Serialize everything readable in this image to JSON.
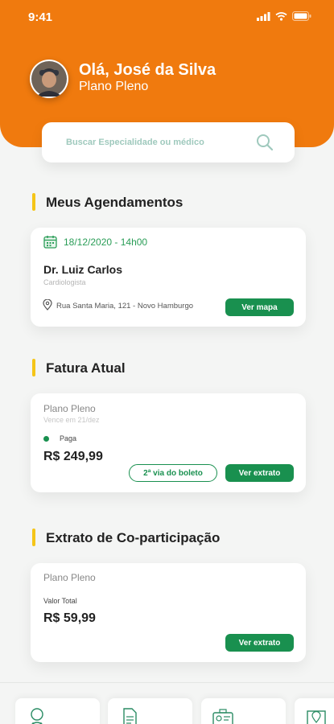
{
  "status_bar": {
    "time": "9:41"
  },
  "user": {
    "greeting": "Olá, José da Silva",
    "plan": "Plano Pleno"
  },
  "search": {
    "placeholder": "Buscar Especialidade ou médico"
  },
  "appointments": {
    "title": "Meus Agendamentos",
    "date": "18/12/2020 - 14h00",
    "doctor": "Dr. Luiz Carlos",
    "specialty": "Cardiologista",
    "address": "Rua Santa Maria, 121 - Novo Hamburgo",
    "map_button": "Ver mapa"
  },
  "invoice": {
    "title": "Fatura Atual",
    "plan": "Plano Pleno",
    "due": "Vence em 21/dez",
    "status": "Paga",
    "amount": "R$ 249,99",
    "boleto_button": "2ª via do boleto",
    "statement_button": "Ver extrato"
  },
  "copay": {
    "title": "Extrato de Co-participação",
    "plan": "Plano Pleno",
    "total_label": "Valor Total",
    "amount": "R$ 59,99",
    "statement_button": "Ver extrato"
  },
  "bottom_nav": [
    {
      "icon": "doctor-icon"
    },
    {
      "icon": "document-icon"
    },
    {
      "icon": "id-card-icon"
    },
    {
      "icon": "map-icon"
    }
  ],
  "colors": {
    "brand": "#f07a0e",
    "accent": "#19904f",
    "marker": "#f5c518"
  }
}
